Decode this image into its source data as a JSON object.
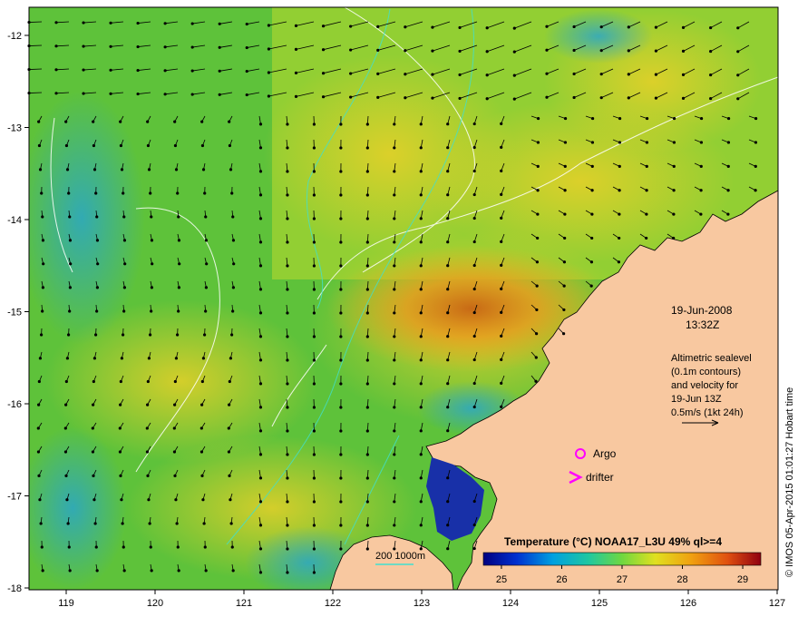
{
  "map": {
    "lon_ticks": [
      "119",
      "120",
      "121",
      "122",
      "123",
      "124",
      "125",
      "126",
      "127"
    ],
    "lat_ticks": [
      "-12",
      "-13",
      "-14",
      "-15",
      "-16",
      "-17",
      "-18"
    ],
    "date": "19-Jun-2008",
    "time": "13:32Z",
    "info_lines": [
      "Altimetric sealevel",
      "(0.1m contours)",
      "and velocity for",
      "19-Jun 13Z",
      "0.5m/s (1kt 24h)"
    ],
    "argo_label": "Argo",
    "drifter_label": "drifter",
    "bathymetry_label": "200  1000m",
    "credit": "© IMOS 05-Apr-2015 01:01:27 Hobart time"
  },
  "colorbar": {
    "title": "Temperature (°C) NOAA17_L3U 49% ql>=4",
    "ticks": [
      "25",
      "26",
      "27",
      "28",
      "29"
    ],
    "range": [
      24.7,
      29.3
    ]
  },
  "colors": {
    "land": "#f8c8a0",
    "argo": "#ff00ff",
    "drifter": "#ff00ff",
    "contour": "#ffffff",
    "isobath": "#40e0d0"
  }
}
